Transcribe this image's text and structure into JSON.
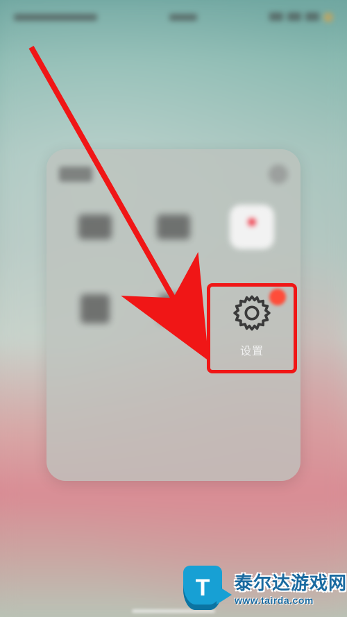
{
  "status": {
    "carrier": "",
    "time": "",
    "battery": ""
  },
  "folder": {
    "title": "",
    "apps": [
      {
        "name": "app-1",
        "label": ""
      },
      {
        "name": "app-2",
        "label": ""
      },
      {
        "name": "app-3-tile",
        "label": ""
      },
      {
        "name": "app-4",
        "label": ""
      },
      {
        "name": "app-5",
        "label": ""
      },
      {
        "name": "settings",
        "label": "设置"
      }
    ]
  },
  "annotation": {
    "target": "settings",
    "highlight_color": "#f01616",
    "arrow_color": "#f01616"
  },
  "watermark": {
    "badge_letter": "T",
    "site_name": "泰尔达游戏网",
    "site_url": "www.tairda.com"
  }
}
